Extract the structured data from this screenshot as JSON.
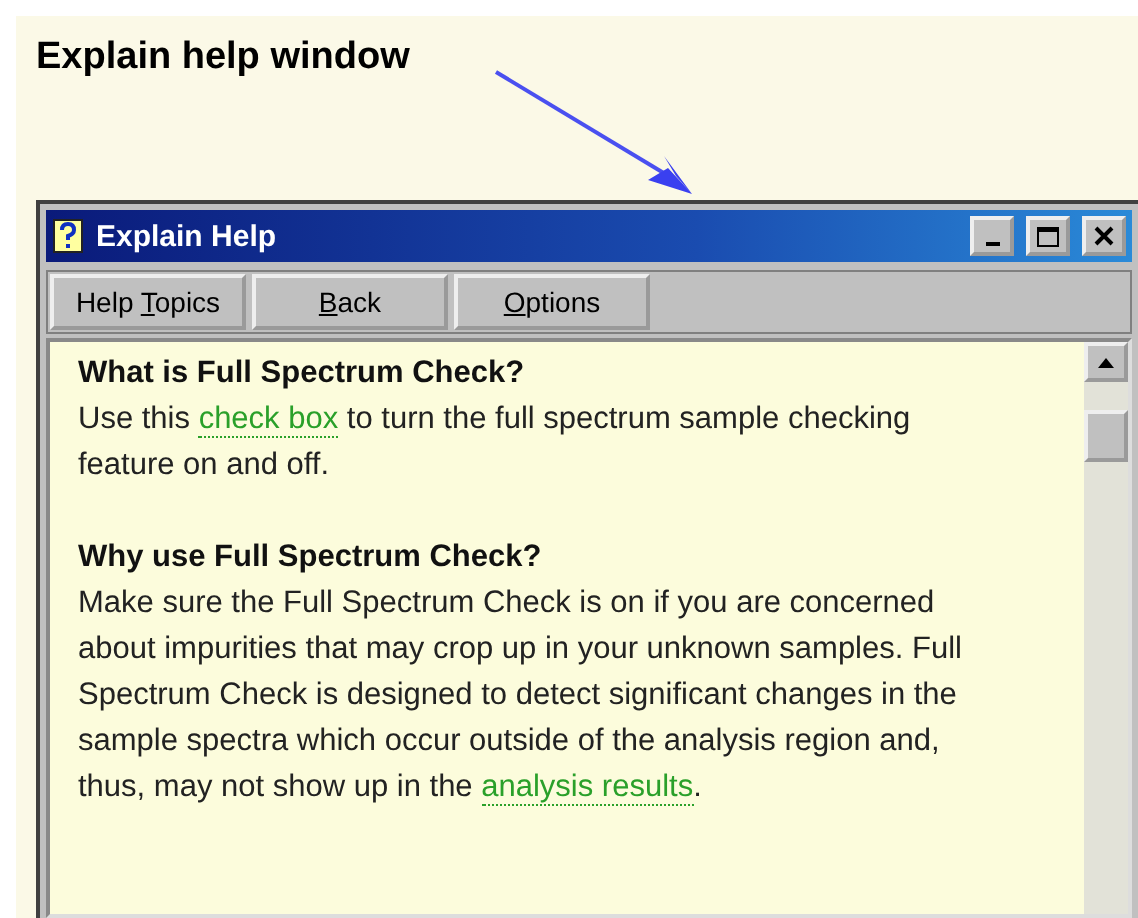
{
  "caption": "Explain help window",
  "window": {
    "title": "Explain Help"
  },
  "toolbar": [
    {
      "pre": "Help ",
      "key": "T",
      "post": "opics"
    },
    {
      "key": "B",
      "post": "ack"
    },
    {
      "key": "O",
      "post": "ptions"
    }
  ],
  "sections": [
    {
      "heading": "What is Full Spectrum Check?",
      "parts": [
        {
          "kind": "text",
          "text": "Use this "
        },
        {
          "kind": "link",
          "text": "check box"
        },
        {
          "kind": "text",
          "text": " to turn the full spectrum sample checking feature on and off."
        }
      ]
    },
    {
      "heading": "Why use Full Spectrum Check?",
      "parts": [
        {
          "kind": "text",
          "text": "Make sure the Full Spectrum Check is on if you are concerned about impurities that may crop up in your unknown samples. Full Spectrum Check is designed to detect significant changes in the sample spectra which occur outside of the analysis region and, thus, may not show up in the "
        },
        {
          "kind": "link",
          "text": "analysis results"
        },
        {
          "kind": "text",
          "text": "."
        }
      ]
    }
  ]
}
